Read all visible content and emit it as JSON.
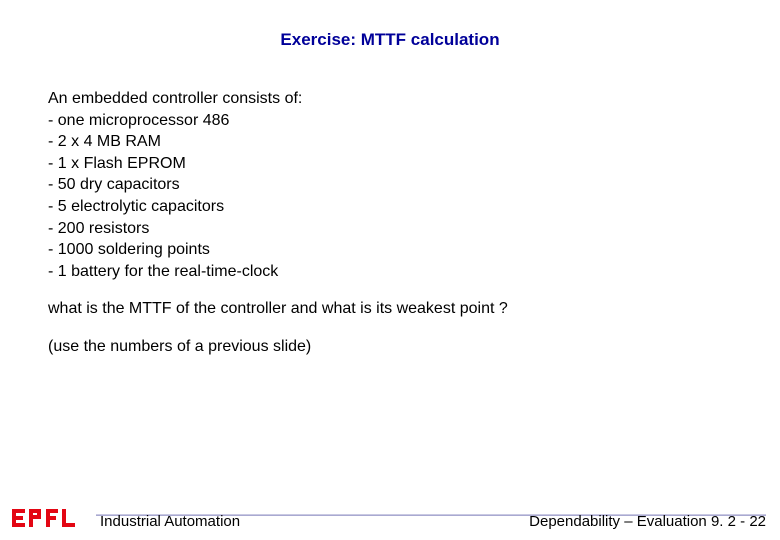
{
  "title": "Exercise: MTTF calculation",
  "intro": "An embedded controller consists of:",
  "items": [
    "- one microprocessor 486",
    "- 2 x 4 MB RAM",
    "- 1 x Flash EPROM",
    "- 50 dry capacitors",
    "- 5 electrolytic capacitors",
    "- 200 resistors",
    "- 1000 soldering points",
    "- 1 battery for the real-time-clock"
  ],
  "question": "what is the MTTF of the controller and what is its weakest point ?",
  "hint": "(use the numbers of a previous slide)",
  "footer": {
    "left": "Industrial Automation",
    "right_prefix": "Dependability – Evaluation ",
    "right_section": "9. 2 - ",
    "right_page": "22"
  },
  "logo_text": "EPFL"
}
